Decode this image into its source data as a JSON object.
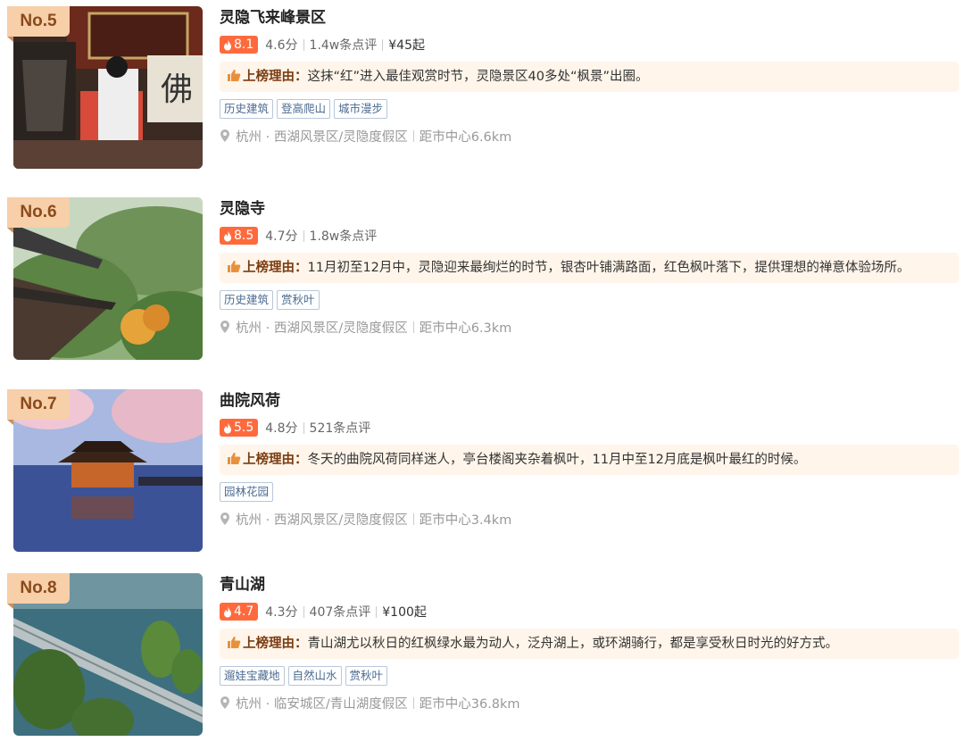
{
  "items": [
    {
      "rank": "No.5",
      "title": "灵隐飞来峰景区",
      "heat": "8.1",
      "score": "4.6分",
      "reviews": "1.4w条点评",
      "price": "¥45起",
      "reason_label": "上榜理由：",
      "reason": "这抹“红”进入最佳观赏时节，灵隐景区40多处“枫景”出圈。",
      "tags": [
        "历史建筑",
        "登高爬山",
        "城市漫步"
      ],
      "location": "杭州 · 西湖风景区/灵隐度假区",
      "distance": "距市中心6.6km"
    },
    {
      "rank": "No.6",
      "title": "灵隐寺",
      "heat": "8.5",
      "score": "4.7分",
      "reviews": "1.8w条点评",
      "reason_label": "上榜理由：",
      "reason": "11月初至12月中，灵隐迎来最绚烂的时节，银杏叶铺满路面，红色枫叶落下，提供理想的禅意体验场所。",
      "tags": [
        "历史建筑",
        "赏秋叶"
      ],
      "location": "杭州 · 西湖风景区/灵隐度假区",
      "distance": "距市中心6.3km"
    },
    {
      "rank": "No.7",
      "title": "曲院风荷",
      "heat": "5.5",
      "score": "4.8分",
      "reviews": "521条点评",
      "reason_label": "上榜理由：",
      "reason": "冬天的曲院风荷同样迷人，亭台楼阁夹杂着枫叶，11月中至12月底是枫叶最红的时候。",
      "tags": [
        "园林花园"
      ],
      "location": "杭州 · 西湖风景区/灵隐度假区",
      "distance": "距市中心3.4km"
    },
    {
      "rank": "No.8",
      "title": "青山湖",
      "heat": "4.7",
      "score": "4.3分",
      "reviews": "407条点评",
      "price": "¥100起",
      "reason_label": "上榜理由：",
      "reason": "青山湖尤以秋日的红枫绿水最为动人，泛舟湖上，或环湖骑行，都是享受秋日时光的好方式。",
      "tags": [
        "遛娃宝藏地",
        "自然山水",
        "赏秋叶"
      ],
      "location": "杭州 · 临安城区/青山湖度假区",
      "distance": "距市中心36.8km"
    }
  ],
  "icons": {
    "heat": "flame-icon",
    "reason": "thumbs-up-icon",
    "location": "location-pin-icon"
  },
  "colors": {
    "heat_badge": "#ff6a3d",
    "rank_badge": "#f7cfa8",
    "reason_bg": "#fff5ea",
    "tag_text": "#4b6b91"
  }
}
